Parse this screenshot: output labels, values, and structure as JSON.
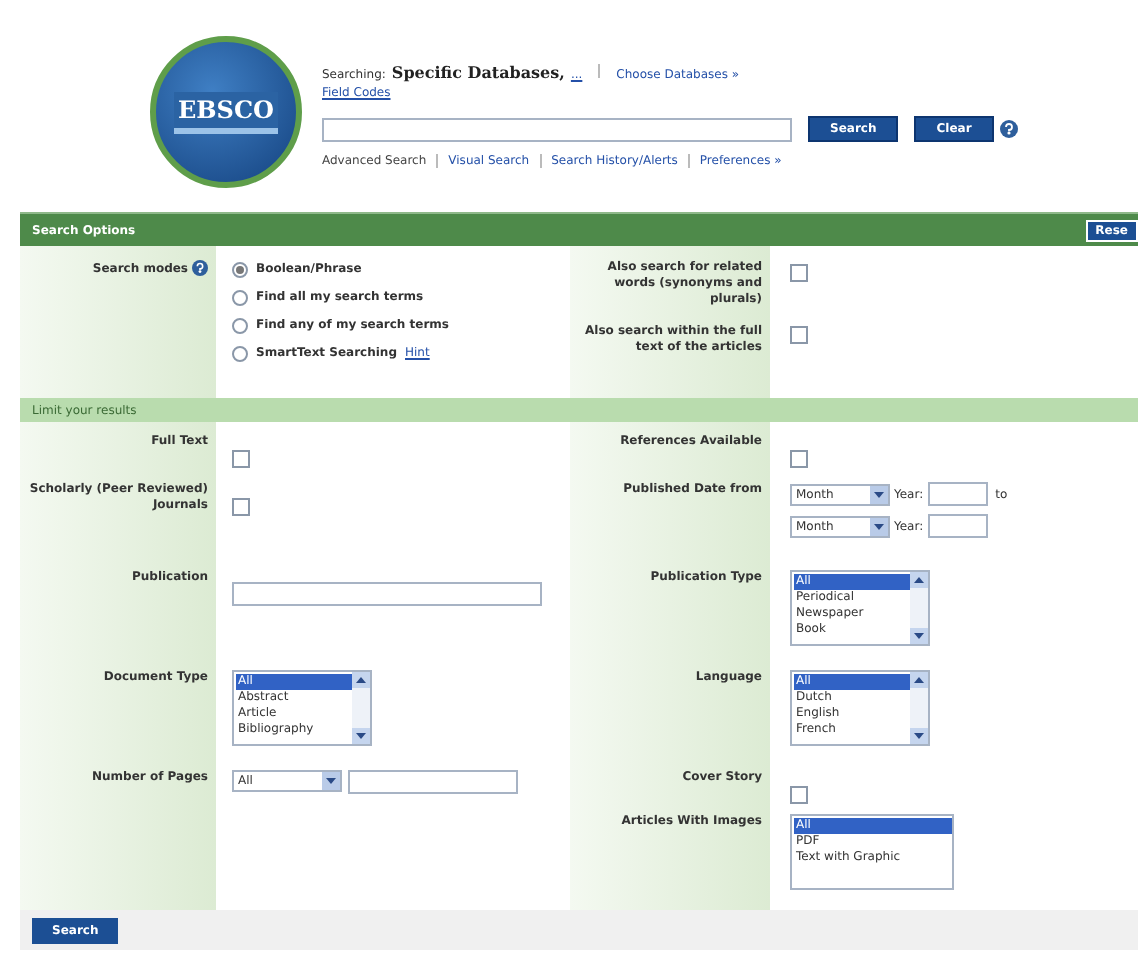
{
  "header": {
    "logo_text": "EBSCO",
    "searching_label": "Searching:",
    "databases": "Specific Databases,",
    "more_link": "...",
    "choose_link": "Choose Databases »",
    "field_codes_link": "Field Codes",
    "buttons": [
      {
        "label": "Search"
      },
      {
        "label": "Clear"
      }
    ],
    "nav": [
      {
        "label": "Advanced Search",
        "kind": "text"
      },
      {
        "label": "Visual Search",
        "kind": "link"
      },
      {
        "label": "Search History/Alerts",
        "kind": "link"
      },
      {
        "label": "Preferences »",
        "kind": "link"
      }
    ]
  },
  "search_options": {
    "title": "Search Options",
    "reset_button": "Rese",
    "modes_label": "Search modes",
    "modes": [
      {
        "label": "Boolean/Phrase",
        "selected": true
      },
      {
        "label": "Find all my search terms",
        "selected": false
      },
      {
        "label": "Find any of my search terms",
        "selected": false
      },
      {
        "label": "SmartText Searching",
        "link": "Hint",
        "selected": false
      }
    ],
    "options": [
      {
        "label": "Also search for related words (synonyms and plurals)",
        "checked": false
      },
      {
        "label": "Also search within the full text of the articles",
        "checked": false
      }
    ]
  },
  "limits": {
    "title": "Limit your results",
    "rows": [
      {
        "left": {
          "label": "Full Text",
          "kind": "checkbox",
          "checked": false
        },
        "right": {
          "label": "References Available",
          "kind": "checkbox",
          "checked": false
        }
      },
      {
        "left": {
          "label": "Scholarly (Peer Reviewed) Journals",
          "kind": "checkbox",
          "checked": false
        },
        "right": {
          "label": "Published Date from",
          "kind": "date",
          "lines": [
            {
              "month": "Month",
              "year_label": "Year:",
              "to": "to"
            },
            {
              "month": "Month",
              "year_label": "Year:"
            }
          ]
        }
      },
      {
        "left": {
          "label": "Publication",
          "kind": "text"
        },
        "right": {
          "label": "Publication Type",
          "kind": "listbox",
          "options": [
            {
              "label": "All",
              "selected": true
            },
            {
              "label": "Periodical",
              "selected": false
            },
            {
              "label": "Newspaper",
              "selected": false
            },
            {
              "label": "Book",
              "selected": false
            }
          ]
        }
      },
      {
        "left": {
          "label": "Document Type",
          "kind": "listbox",
          "options": [
            {
              "label": "All",
              "selected": true
            },
            {
              "label": "Abstract",
              "selected": false
            },
            {
              "label": "Article",
              "selected": false
            },
            {
              "label": "Bibliography",
              "selected": false
            }
          ]
        },
        "right": {
          "label": "Language",
          "kind": "listbox",
          "options": [
            {
              "label": "All",
              "selected": true
            },
            {
              "label": "Dutch",
              "selected": false
            },
            {
              "label": "English",
              "selected": false
            },
            {
              "label": "French",
              "selected": false
            }
          ]
        }
      },
      {
        "left": {
          "label": "Number of Pages",
          "kind": "select_text",
          "value": "All"
        },
        "right": {
          "label": "Cover Story",
          "kind": "checkbox",
          "checked": false
        }
      },
      {
        "right": {
          "label": "Articles With Images",
          "kind": "listbox",
          "noscroll": true,
          "options": [
            {
              "label": "All",
              "selected": true
            },
            {
              "label": "PDF",
              "selected": false
            },
            {
              "label": "Text with Graphic",
              "selected": false
            }
          ]
        }
      }
    ]
  },
  "footer": {
    "search_button": "Search"
  }
}
